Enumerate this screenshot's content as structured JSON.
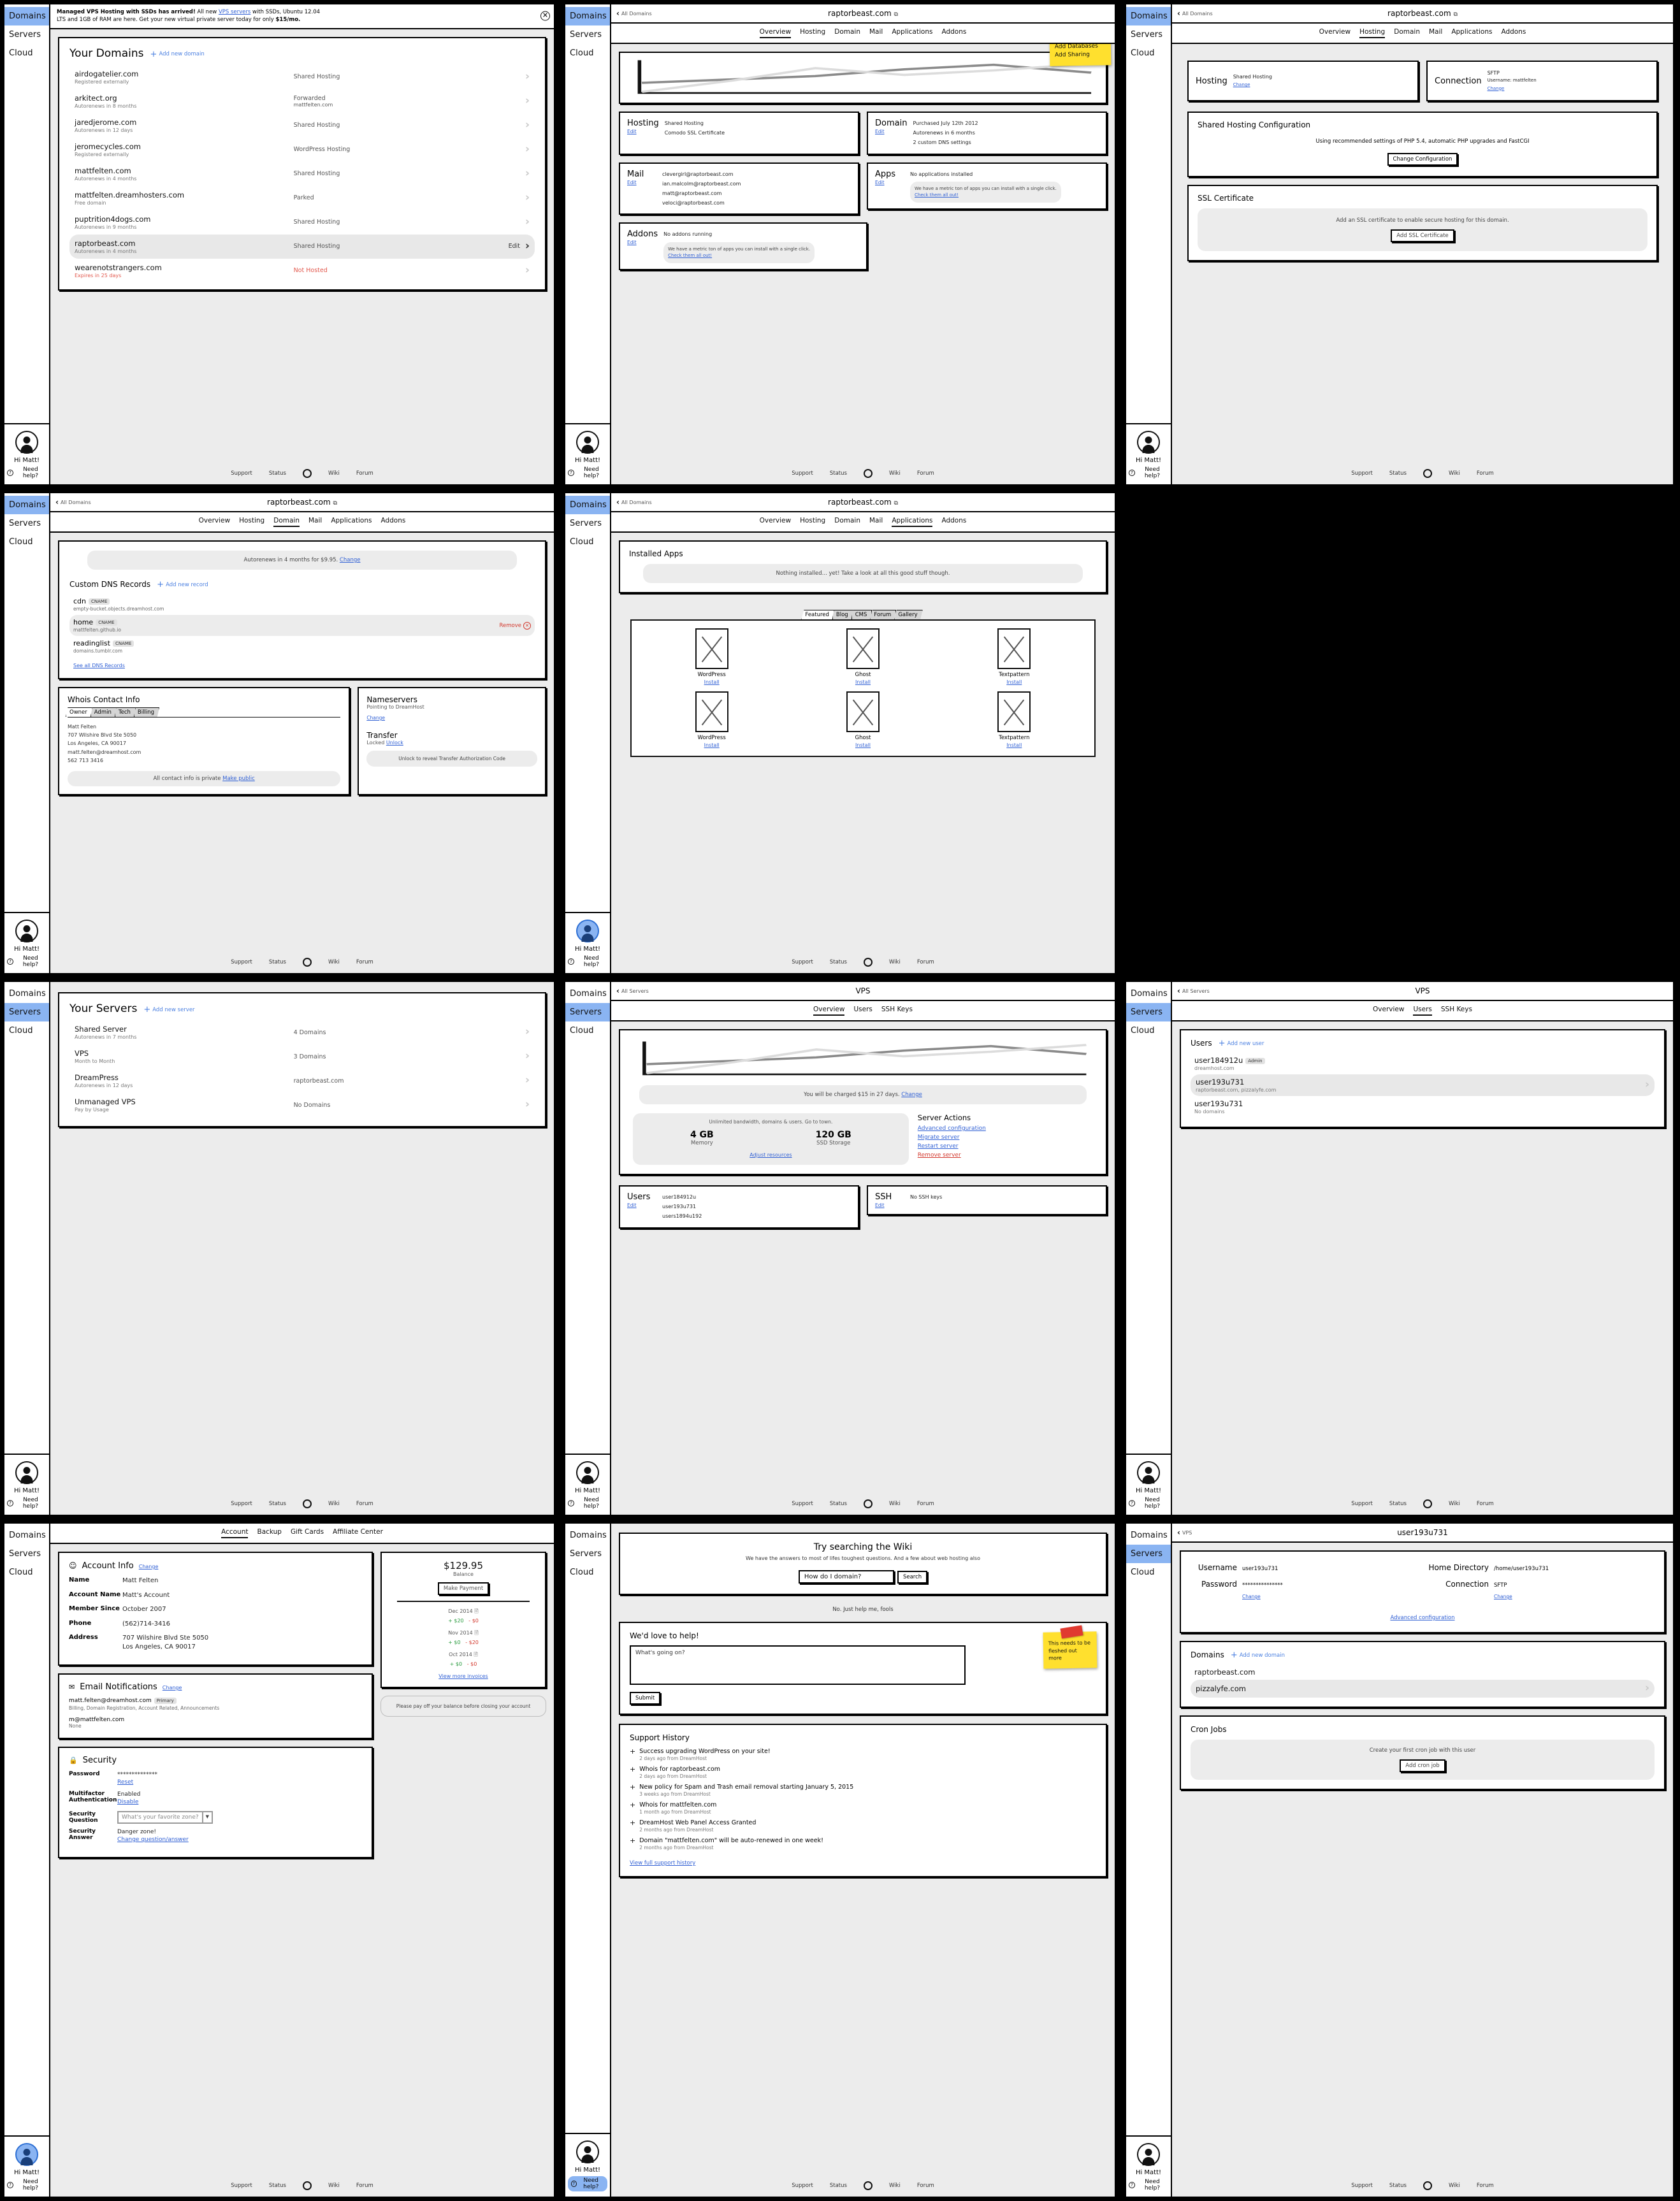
{
  "sidebar": {
    "items": [
      "Domains",
      "Servers",
      "Cloud"
    ],
    "greeting": "Hi Matt!",
    "help": "Need help?"
  },
  "footer": {
    "links": [
      "Support",
      "Status",
      "Wiki",
      "Forum"
    ]
  },
  "banner": {
    "line1_a": "Managed VPS Hosting with SSDs has arrived!",
    "line1_b": " All new ",
    "link": "VPS servers",
    "line1_c": " with SSDs, Ubuntu 12.04",
    "line2_a": "LTS and 1GB of RAM are here. Get your new virtual private server today for only ",
    "line2_b": "$15/mo."
  },
  "domains_list": {
    "title": "Your Domains",
    "add_label": "Add new domain",
    "rows": [
      {
        "name": "airdogatelier.com",
        "sub": "Registered externally",
        "status": "Shared Hosting",
        "status2": ""
      },
      {
        "name": "arkitect.org",
        "sub": "Autorenews in 8 months",
        "status": "Forwarded",
        "status2": "mattfelten.com"
      },
      {
        "name": "jaredjerome.com",
        "sub": "Autorenews in 12 days",
        "status": "Shared Hosting",
        "status2": ""
      },
      {
        "name": "jeromecycles.com",
        "sub": "Registered externally",
        "status": "WordPress Hosting",
        "status2": ""
      },
      {
        "name": "mattfelten.com",
        "sub": "Autorenews in 4 months",
        "status": "Shared Hosting",
        "status2": ""
      },
      {
        "name": "mattfelten.dreamhosters.com",
        "sub": "Free domain",
        "status": "Parked",
        "status2": ""
      },
      {
        "name": "puptrition4dogs.com",
        "sub": "Autorenews in 9 months",
        "status": "Shared Hosting",
        "status2": ""
      },
      {
        "name": "raptorbeast.com",
        "sub": "Autorenews in 4 months",
        "status": "Shared Hosting",
        "status2": "",
        "selected": true,
        "edit": "Edit"
      },
      {
        "name": "wearenotstrangers.com",
        "sub": "Expires in 25 days",
        "status": "Not Hosted",
        "status2": "",
        "danger": true
      }
    ]
  },
  "domain_detail": {
    "back": "All Domains",
    "title": "raptorbeast.com",
    "tabs": [
      "Overview",
      "Hosting",
      "Domain",
      "Mail",
      "Applications",
      "Addons"
    ]
  },
  "overview": {
    "sticky": {
      "l1": "Add Databases",
      "l2": "Add Sharing"
    },
    "cards": [
      {
        "title": "Hosting",
        "edit": "Edit",
        "lines": [
          "Shared Hosting",
          "Comodo SSL Certificate"
        ]
      },
      {
        "title": "Domain",
        "edit": "Edit",
        "lines": [
          "Purchased July 12th 2012",
          "Autorenews in 6 months",
          "2 custom DNS settings"
        ]
      },
      {
        "title": "Mail",
        "edit": "Edit",
        "lines": [
          "clevergirl@raptorbeast.com",
          "ian.malcolm@raptorbeast.com",
          "matt@raptorbeast.com",
          "veloci@raptorbeast.com"
        ]
      },
      {
        "title": "Apps",
        "edit": "Edit",
        "lines": [
          "No applications installed"
        ],
        "promo": "We have a metric ton of apps you can install with a single click.",
        "promo_link": "Check them all out!"
      },
      {
        "title": "Addons",
        "edit": "Edit",
        "lines": [
          "No addons running"
        ],
        "promo": "We have a metric ton of apps you can install with a single click.",
        "promo_link": "Check them all out!"
      }
    ]
  },
  "hosting_tab": {
    "hosting": {
      "title": "Hosting",
      "value": "Shared Hosting",
      "link": "Change"
    },
    "connection": {
      "title": "Connection",
      "value": "SFTP",
      "username": "Username: mattfelten",
      "link": "Change"
    },
    "config": {
      "title": "Shared Hosting Configuration",
      "desc": "Using recommended settings of PHP 5.4, automatic PHP upgrades and FastCGI",
      "button": "Change Configuration"
    },
    "ssl": {
      "title": "SSL Certificate",
      "desc": "Add an SSL certificate to enable secure hosting for this domain.",
      "button": "Add SSL Certificate"
    }
  },
  "domain_tab": {
    "renew_text": "Autorenews in 4 months for $9.95. ",
    "renew_link": "Change",
    "dns_title": "Custom DNS Records",
    "dns_add": "Add new record",
    "dns_records": [
      {
        "name": "cdn",
        "type": "CNAME",
        "value": "empty-bucket.objects.dreamhost.com"
      },
      {
        "name": "home",
        "type": "CNAME",
        "value": "mattfelten.github.io",
        "selected": true,
        "remove": "Remove"
      },
      {
        "name": "readinglist",
        "type": "CNAME",
        "value": "domains.tumblr.com"
      }
    ],
    "see_all": "See all DNS Records",
    "whois": {
      "title": "Whois Contact Info",
      "tabs": [
        "Owner",
        "Admin",
        "Tech",
        "Billing"
      ],
      "lines": [
        "Matt Felten",
        "707 Wilshire Blvd Ste 5050",
        "Los Angeles, CA 90017",
        "matt.felten@dreamhost.com",
        "562 713 3416"
      ],
      "private_text": "All contact info is private ",
      "private_link": "Make public"
    },
    "nameservers": {
      "title": "Nameservers",
      "desc": "Pointing to DreamHost",
      "link": "Change"
    },
    "transfer": {
      "title": "Transfer",
      "status": "Locked ",
      "link": "Unlock",
      "note": "Unlock to reveal Transfer Authorization Code"
    }
  },
  "apps_tab": {
    "installed_title": "Installed Apps",
    "empty": "Nothing installed... yet! Take a look at all this good stuff though.",
    "tabs": [
      "Featured",
      "Blog",
      "CMS",
      "Forum",
      "Gallery"
    ],
    "apps": [
      {
        "name": "WordPress",
        "action": "Install"
      },
      {
        "name": "Ghost",
        "action": "Install"
      },
      {
        "name": "Textpattern",
        "action": "Install"
      },
      {
        "name": "WordPress",
        "action": "Install"
      },
      {
        "name": "Ghost",
        "action": "Install"
      },
      {
        "name": "Textpattern",
        "action": "Install"
      }
    ]
  },
  "servers_list": {
    "title": "Your Servers",
    "add_label": "Add new server",
    "rows": [
      {
        "name": "Shared Server",
        "sub": "Autorenews in 7 months",
        "status": "4 Domains"
      },
      {
        "name": "VPS",
        "sub": "Month to Month",
        "status": "3 Domains"
      },
      {
        "name": "DreamPress",
        "sub": "Autorenews in 12 days",
        "status": "raptorbeast.com"
      },
      {
        "name": "Unmanaged VPS",
        "sub": "Pay by Usage",
        "status": "No Domains"
      }
    ]
  },
  "vps": {
    "back": "All Servers",
    "title": "VPS",
    "tabs": [
      "Overview",
      "Users",
      "SSH Keys"
    ],
    "charge_text": "You will be charged $15 in 27 days. ",
    "charge_link": "Change",
    "resources_note": "Unlimited bandwidth, domains & users. Go to town.",
    "memory": "4 GB",
    "memory_label": "Memory",
    "storage": "120 GB",
    "storage_label": "SSD Storage",
    "adjust_link": "Adjust resources",
    "actions_title": "Server Actions",
    "actions": [
      "Advanced configuration",
      "Migrate server",
      "Restart server",
      "Remove server"
    ],
    "users_card": {
      "title": "Users",
      "edit": "Edit",
      "lines": [
        "user184912u",
        "user193u731",
        "users1894u192"
      ]
    },
    "ssh_card": {
      "title": "SSH",
      "edit": "Edit",
      "lines": [
        "No SSH keys"
      ]
    },
    "users_tab": {
      "title": "Users",
      "add_label": "Add new user",
      "rows": [
        {
          "name": "user184912u",
          "badge": "Admin",
          "sub": "dreamhost.com"
        },
        {
          "name": "user193u731",
          "sub": "raptorbeast.com, pizzalyfe.com",
          "selected": true
        },
        {
          "name": "user193u731",
          "sub": "No domains"
        }
      ]
    }
  },
  "user_detail": {
    "back": "VPS",
    "title": "user193u731",
    "username_label": "Username",
    "username_value": "user193u731",
    "password_label": "Password",
    "password_value": "***************",
    "password_link": "Change",
    "home_label": "Home Directory",
    "home_value": "/home/user193u731",
    "connection_label": "Connection",
    "connection_value": "SFTP",
    "connection_link": "Change",
    "advanced_link": "Advanced configuration",
    "domains_title": "Domains",
    "domains_add": "Add new domain",
    "domains": [
      {
        "name": "raptorbeast.com"
      },
      {
        "name": "pizzalyfe.com",
        "selected": true
      }
    ],
    "cron_title": "Cron Jobs",
    "cron_desc": "Create your first cron job with this user",
    "cron_button": "Add cron job"
  },
  "account": {
    "tabs": [
      "Account",
      "Backup",
      "Gift Cards",
      "Affiliate Center"
    ],
    "info_title": "Account Info",
    "info_change": "Change",
    "fields": [
      {
        "k": "Name",
        "v": "Matt Felten"
      },
      {
        "k": "Account Name",
        "v": "Matt's Account"
      },
      {
        "k": "Member Since",
        "v": "October 2007"
      },
      {
        "k": "Phone",
        "v": "(562)714-3416"
      },
      {
        "k": "Address",
        "v": "707 Wilshire Blvd Ste 5050\nLos Angeles, CA 90017"
      }
    ],
    "email_title": "Email Notifications",
    "email_change": "Change",
    "emails": [
      {
        "addr": "matt.felten@dreamhost.com",
        "badge": "Primary",
        "sub": "Billing, Domain Registration, Account Related, Announcements"
      },
      {
        "addr": "m@mattfelten.com",
        "sub": "None"
      }
    ],
    "security_title": "Security",
    "password_k": "Password",
    "password_v": "**************",
    "password_link": "Reset",
    "mfa_k": "Multifactor Authentication",
    "mfa_v": "Enabled",
    "mfa_link": "Disable",
    "question_k": "Security Question",
    "question_v": "What's your favorite zone?",
    "answer_k": "Security Answer",
    "answer_v": "Danger zone!",
    "answer_link": "Change question/answer",
    "balance": "$129.95",
    "balance_label": "Balance",
    "pay_button": "Make Payment",
    "invoices": [
      {
        "month": "Dec 2014",
        "plus": "+ $20",
        "minus": "- $0"
      },
      {
        "month": "Nov 2014",
        "plus": "+ $0",
        "minus": "- $20"
      },
      {
        "month": "Oct 2014",
        "plus": "+ $0",
        "minus": "- $0"
      }
    ],
    "more_invoices": "View more invoices",
    "close_note": "Please pay off your balance before closing your account"
  },
  "support": {
    "wiki_title": "Try searching the Wiki",
    "wiki_desc": "We have the answers to most of lifes toughest questions. And a few about web hosting also",
    "wiki_input": "How do I domain?",
    "wiki_button": "Search",
    "divider": "No. Just help me, fools",
    "help_title": "We'd love to help!",
    "help_placeholder": "What's going on?",
    "submit": "Submit",
    "sticky": {
      "l1": "This needs to be",
      "l2": "fleshed out more"
    },
    "history_title": "Support History",
    "history": [
      {
        "t": "Success upgrading WordPress on your site!",
        "s": "2 days ago from DreamHost"
      },
      {
        "t": "Whois for raptorbeast.com",
        "s": "2 days ago from DreamHost"
      },
      {
        "t": "New policy for Spam and Trash email removal starting January 5, 2015",
        "s": "3 weeks ago from DreamHost"
      },
      {
        "t": "Whois for mattfelten.com",
        "s": "1 month ago from DreamHost"
      },
      {
        "t": "DreamHost Web Panel Access Granted",
        "s": "2 months ago from DreamHost"
      },
      {
        "t": "Domain \"mattfelten.com\" will be auto-renewed in one week!",
        "s": "2 months ago from DreamHost"
      }
    ],
    "view_full": "View full support history"
  },
  "chart_data": {
    "type": "line",
    "title": "",
    "xlabel": "",
    "ylabel": "",
    "grid": false,
    "legend": "none",
    "x": [
      0,
      1,
      2,
      3,
      4,
      5
    ],
    "series": [
      {
        "name": "dark",
        "color": "#8a8a8a",
        "values": [
          30,
          38,
          44,
          62,
          72,
          56
        ]
      },
      {
        "name": "light",
        "color": "#dcdcdc",
        "values": [
          4,
          34,
          66,
          52,
          62,
          74
        ]
      }
    ],
    "ylim": [
      0,
      100
    ]
  }
}
